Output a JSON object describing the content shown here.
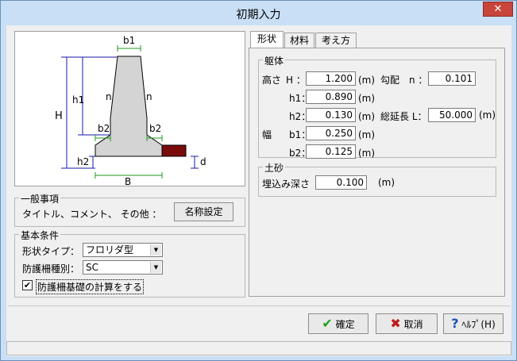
{
  "window": {
    "title": "初期入力",
    "close_label": "✕"
  },
  "diagram": {
    "labels": {
      "b1": "b1",
      "n_left": "n",
      "n_right": "n",
      "h1": "h1",
      "H": "H",
      "b2_left": "b2",
      "b2_right": "b2",
      "h2": "h2",
      "d": "d",
      "B": "B"
    },
    "colors": {
      "line": "#1a1aa8",
      "green": "#1c9a1c",
      "body": "#d4d4d4",
      "soil": "#7b0c0c"
    }
  },
  "general": {
    "group_label": "一般事項",
    "caption": "タイトル、コメント、 その他 ：",
    "name_button": "名称設定"
  },
  "basic": {
    "group_label": "基本条件",
    "shape_label": "形状タイプ：",
    "shape_value": "フロリダ型",
    "barrier_label": "防護柵種別：",
    "barrier_value": "SC",
    "check_label": "防護柵基礎の計算をする",
    "checked": true
  },
  "tabs": [
    {
      "label": "形状",
      "active": true
    },
    {
      "label": "材料",
      "active": false
    },
    {
      "label": "考え方",
      "active": false
    }
  ],
  "body": {
    "group_label": "躯体",
    "height_label": "高さ",
    "H_label": "H ：",
    "H_value": "1.200",
    "h1_label": "h1：",
    "h1_value": "0.890",
    "h2_label": "h2：",
    "h2_value": "0.130",
    "width_label": "幅",
    "b1_label": "b1：",
    "b1_value": "0.250",
    "b2_label": "b2：",
    "b2_value": "0.125",
    "unit": "(m)",
    "slope_label": "勾配　n ：",
    "slope_value": "0.101",
    "length_label": "総延長 L：",
    "length_value": "50.000",
    "length_unit": "(m)"
  },
  "soil": {
    "group_label": "土砂",
    "depth_label": "埋込み深さ",
    "depth_value": "0.100",
    "unit": "(m)"
  },
  "buttons": {
    "ok": "確定",
    "cancel": "取消",
    "help": "ﾍﾙﾌﾟ(H)"
  }
}
